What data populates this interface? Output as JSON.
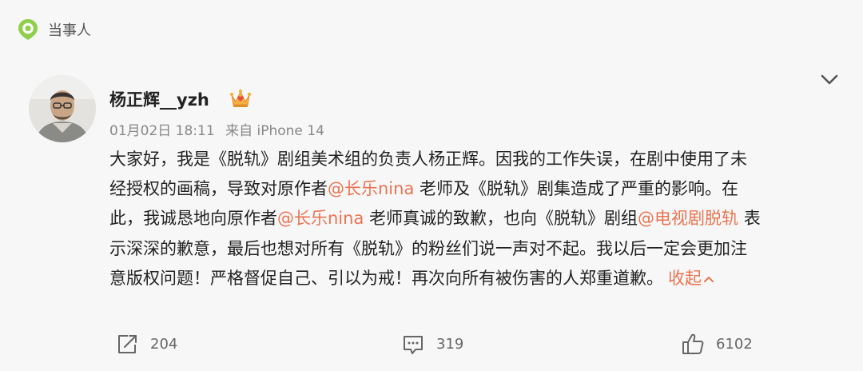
{
  "topic": {
    "label": "当事人"
  },
  "post": {
    "username": "杨正辉__yzh",
    "date": "01月02日 18:11",
    "source": "来自 iPhone 14",
    "lines": [
      [
        "大家好，我是《脱轨》剧组美术组的负责人杨正辉。因我的工作失误，在剧中使用了未"
      ],
      [
        "经授权的画稿，导致对原作者",
        "@长乐nina",
        " 老师及《脱轨》剧集造成了严重的影响。在"
      ],
      [
        "此，我诚恳地向原作者",
        "@长乐nina",
        " 老师真诚的致歉，也向《脱轨》剧组",
        "@电视剧脱轨",
        " 表"
      ],
      [
        "示深深的歉意，最后也想对所有《脱轨》的粉丝们说一声对不起。我以后一定会更加注"
      ],
      [
        "意版权问题！严格督促自己、引以为戒！再次向所有被伤害的人郑重道歉。"
      ]
    ],
    "collapse_label": "收起"
  },
  "actions": {
    "share_count": "204",
    "comment_count": "319",
    "like_count": "6102"
  },
  "colors": {
    "mention": "#eb7350",
    "topic_icon": "#8fcf4a"
  }
}
